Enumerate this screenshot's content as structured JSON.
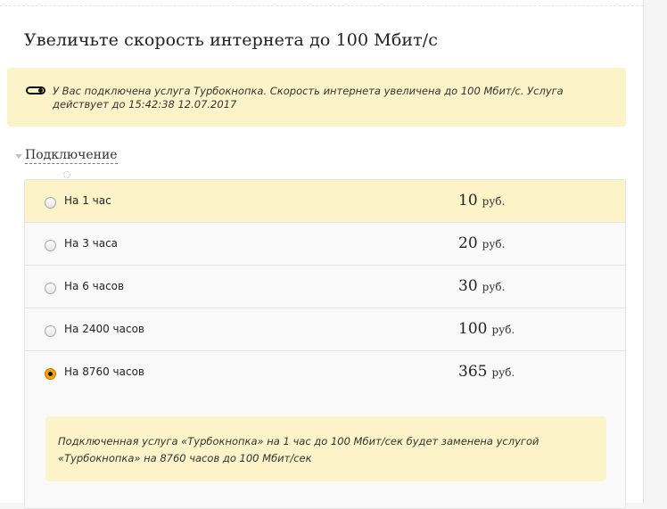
{
  "title": "Увеличьте скорость интернета до 100 Мбит/с",
  "notice": {
    "icon": "toggle-icon",
    "line1": "У Вас подключена услуга Турбокнопка. Скорость интернета увеличена до 100 Мбит/с. Услуга",
    "line2": "действует до 15:42:38 12.07.2017"
  },
  "section": {
    "label": "Подключение",
    "icon": "caret-down-icon"
  },
  "options": [
    {
      "label": "На 1 час",
      "price": "10",
      "currency": "руб.",
      "selected": false,
      "highlighted": true
    },
    {
      "label": "На 3 часа",
      "price": "20",
      "currency": "руб.",
      "selected": false,
      "highlighted": false
    },
    {
      "label": "На 6 часов",
      "price": "30",
      "currency": "руб.",
      "selected": false,
      "highlighted": false
    },
    {
      "label": "На 2400 часов",
      "price": "100",
      "currency": "руб.",
      "selected": false,
      "highlighted": false
    },
    {
      "label": "На 8760 часов",
      "price": "365",
      "currency": "руб.",
      "selected": true,
      "highlighted": false
    }
  ],
  "info": {
    "line1": "Подключенная услуга «Турбокнопка» на 1 час до 100 Мбит/сек будет заменена услугой",
    "line2": "«Турбокнопка» на 8760 часов до 100 Мбит/сек"
  },
  "colors": {
    "accent": "#f6a200",
    "highlight_bg": "#fcf4c8",
    "row_bg": "#f9f9f9",
    "border": "#e4e4e4"
  }
}
